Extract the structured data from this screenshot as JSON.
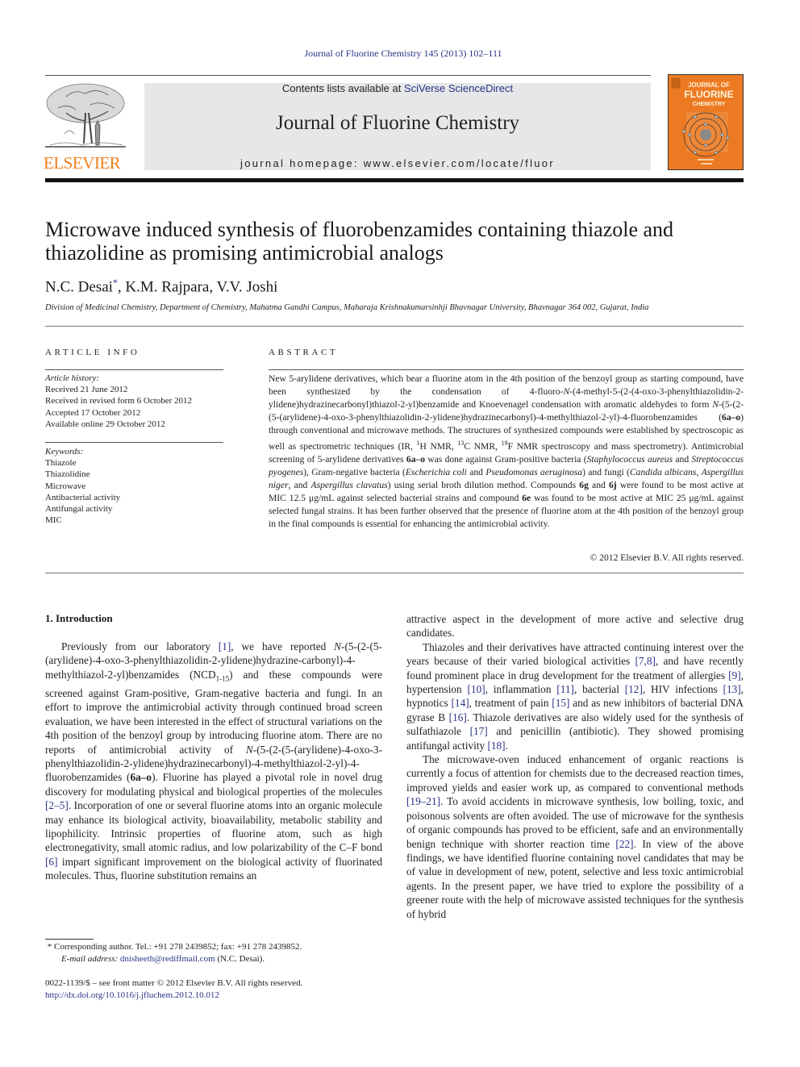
{
  "header": {
    "citation": "Journal of Fluorine Chemistry 145 (2013) 102–111",
    "contents_prefix": "Contents lists available at ",
    "contents_link": "SciVerse ScienceDirect",
    "journal_name": "Journal of Fluorine Chemistry",
    "homepage": "journal homepage: www.elsevier.com/locate/fluor",
    "publisher_wordmark": "ELSEVIER",
    "cover": {
      "line1": "JOURNAL OF",
      "line2": "FLUORINE",
      "line3": "CHEMISTRY"
    },
    "colors": {
      "link": "#2a3388",
      "elsevier_orange": "#f07f1b",
      "cover_orange": "#ec7a22",
      "header_gray": "#e6e7e8"
    }
  },
  "article": {
    "title": "Microwave induced synthesis of fluorobenzamides containing thiazole and thiazolidine as promising antimicrobial analogs",
    "authors": [
      {
        "name": "N.C. Desai",
        "mark": "*"
      },
      {
        "name": "K.M. Rajpara",
        "mark": ""
      },
      {
        "name": "V.V. Joshi",
        "mark": ""
      }
    ],
    "affiliation": "Division of Medicinal Chemistry, Department of Chemistry, Mahatma Gandhi Campus, Maharaja Krishnakumarsinhji Bhavnagar University, Bhavnagar 364 002, Gujarat, India"
  },
  "article_info": {
    "label": "ARTICLE INFO",
    "history_heading": "Article history:",
    "history": [
      "Received 21 June 2012",
      "Received in revised form 6 October 2012",
      "Accepted 17 October 2012",
      "Available online 29 October 2012"
    ],
    "keywords_heading": "Keywords:",
    "keywords": [
      "Thiazole",
      "Thiazolidine",
      "Microwave",
      "Antibacterial activity",
      "Antifungal activity",
      "MIC"
    ]
  },
  "abstract": {
    "label": "ABSTRACT",
    "segments": [
      {
        "t": "New 5-arylidene derivatives, which bear a fluorine atom in the 4th position of the benzoyl group as starting compound, have been synthesized by the condensation of 4-fluoro-"
      },
      {
        "t": "N",
        "s": "i"
      },
      {
        "t": "-(4-methyl-5-(2-(4-oxo-3-phenylthiazolidin-2-ylidene)hydrazinecarbonyl)thiazol-2-yl)benzamide and Knoevenagel condensation with aromatic aldehydes to form "
      },
      {
        "t": "N",
        "s": "i"
      },
      {
        "t": "-(5-(2-(5-(arylidene)-4-oxo-3-phenylthiazolidin-2-ylidene)hydrazinecarbonyl)-4-methylthiazol-2-yl)-4-fluorobenzamides ("
      },
      {
        "t": "6a–o",
        "s": "b"
      },
      {
        "t": ") through conventional and microwave methods. The structures of synthesized compounds were established by spectroscopic as well as spectrometric techniques (IR, "
      },
      {
        "t": "1",
        "s": "sup"
      },
      {
        "t": "H NMR, "
      },
      {
        "t": "13",
        "s": "sup"
      },
      {
        "t": "C NMR, "
      },
      {
        "t": "19",
        "s": "sup"
      },
      {
        "t": "F NMR spectroscopy and mass spectrometry). Antimicrobial screening of 5-arylidene derivatives "
      },
      {
        "t": "6a–o",
        "s": "b"
      },
      {
        "t": " was done against Gram-positive bacteria ("
      },
      {
        "t": "Staphylococcus aureus",
        "s": "i"
      },
      {
        "t": " and "
      },
      {
        "t": "Streptococcus pyogenes",
        "s": "i"
      },
      {
        "t": "), Gram-negative bacteria ("
      },
      {
        "t": "Escherichia coli",
        "s": "i"
      },
      {
        "t": " and "
      },
      {
        "t": "Pseudomonas aeruginosa",
        "s": "i"
      },
      {
        "t": ") and fungi ("
      },
      {
        "t": "Candida albicans",
        "s": "i"
      },
      {
        "t": ", "
      },
      {
        "t": "Aspergillus niger",
        "s": "i"
      },
      {
        "t": ", and "
      },
      {
        "t": "Aspergillus clavatus",
        "s": "i"
      },
      {
        "t": ") using serial broth dilution method. Compounds "
      },
      {
        "t": "6g",
        "s": "b"
      },
      {
        "t": " and "
      },
      {
        "t": "6j",
        "s": "b"
      },
      {
        "t": " were found to be most active at MIC 12.5 μg/mL against selected bacterial strains and compound "
      },
      {
        "t": "6e",
        "s": "b"
      },
      {
        "t": " was found to be most active at MIC 25 μg/mL against selected fungal strains. It has been further observed that the presence of fluorine atom at the 4th position of the benzoyl group in the final compounds is essential for enhancing the antimicrobial activity."
      }
    ],
    "copyright": "© 2012 Elsevier B.V. All rights reserved."
  },
  "introduction": {
    "heading": "1.  Introduction",
    "left_paragraphs": [
      [
        {
          "t": "Previously from our laboratory "
        },
        {
          "t": "[1]",
          "s": "ref"
        },
        {
          "t": ", we have reported "
        },
        {
          "t": "N",
          "s": "i"
        },
        {
          "t": "-(5-(2-(5-(arylidene)-4-oxo-3-phenylthiazolidin-2-ylidene)hydrazine-carbonyl)-4-methylthiazol-2-yl)benzamides (NCD"
        },
        {
          "t": "1-15",
          "s": "sub"
        },
        {
          "t": ") and these compounds were screened against Gram-positive, Gram-negative bacteria and fungi. In an effort to improve the antimicrobial activity through continued broad screen evaluation, we have been interested in the effect of structural variations on the 4th position of the benzoyl group by introducing fluorine atom. There are no reports of antimicrobial activity of "
        },
        {
          "t": "N",
          "s": "i"
        },
        {
          "t": "-(5-(2-(5-(arylidene)-4-oxo-3-phenylthiazolidin-2-ylidene)hydrazinecarbonyl)-4-methylthiazol-2-yl)-4-fluorobenzamides ("
        },
        {
          "t": "6a–o",
          "s": "b"
        },
        {
          "t": "). Fluorine has played a pivotal role in novel drug discovery for modulating physical and biological properties of the molecules "
        },
        {
          "t": "[2–5]",
          "s": "ref"
        },
        {
          "t": ". Incorporation of one or several fluorine atoms into an organic molecule may enhance its biological activity, bioavailability, metabolic stability and lipophilicity. Intrinsic properties of fluorine atom, such as high electronegativity, small atomic radius, and low polarizability of the C–F bond "
        },
        {
          "t": "[6]",
          "s": "ref"
        },
        {
          "t": " impart significant improvement on the biological activity of fluorinated molecules. Thus, fluorine substitution remains an"
        }
      ]
    ],
    "right_paragraphs": [
      [
        {
          "t": "attractive aspect in the development of more active and selective drug candidates."
        }
      ],
      [
        {
          "t": "Thiazoles and their derivatives have attracted continuing interest over the years because of their varied biological activities "
        },
        {
          "t": "[7,8]",
          "s": "ref"
        },
        {
          "t": ", and have recently found prominent place in drug development for the treatment of allergies "
        },
        {
          "t": "[9]",
          "s": "ref"
        },
        {
          "t": ", hypertension "
        },
        {
          "t": "[10]",
          "s": "ref"
        },
        {
          "t": ", inflammation "
        },
        {
          "t": "[11]",
          "s": "ref"
        },
        {
          "t": ", bacterial "
        },
        {
          "t": "[12]",
          "s": "ref"
        },
        {
          "t": ", HIV infections "
        },
        {
          "t": "[13]",
          "s": "ref"
        },
        {
          "t": ", hypnotics "
        },
        {
          "t": "[14]",
          "s": "ref"
        },
        {
          "t": ", treatment of pain "
        },
        {
          "t": "[15]",
          "s": "ref"
        },
        {
          "t": " and as new inhibitors of bacterial DNA gyrase B "
        },
        {
          "t": "[16]",
          "s": "ref"
        },
        {
          "t": ". Thiazole derivatives are also widely used for the synthesis of sulfathiazole "
        },
        {
          "t": "[17]",
          "s": "ref"
        },
        {
          "t": " and penicillin (antibiotic). They showed promising antifungal activity "
        },
        {
          "t": "[18]",
          "s": "ref"
        },
        {
          "t": "."
        }
      ],
      [
        {
          "t": "The microwave-oven induced enhancement of organic reactions is currently a focus of attention for chemists due to the decreased reaction times, improved yields and easier work up, as compared to conventional methods "
        },
        {
          "t": "[19–21]",
          "s": "ref"
        },
        {
          "t": ". To avoid accidents in microwave synthesis, low boiling, toxic, and poisonous solvents are often avoided. The use of microwave for the synthesis of organic compounds has proved to be efficient, safe and an environmentally benign technique with shorter reaction time "
        },
        {
          "t": "[22]",
          "s": "ref"
        },
        {
          "t": ". In view of the above findings, we have identified fluorine containing novel candidates that may be of value in development of new, potent, selective and less toxic antimicrobial agents. In the present paper, we have tried to explore the possibility of a greener route with the help of microwave assisted techniques for the synthesis of hybrid"
        }
      ]
    ]
  },
  "footnote": {
    "mark": "*",
    "corresponding": "Corresponding author. Tel.: +91 278 2439852; fax: +91 278 2439852.",
    "email_label": "E-mail address:",
    "email": "dnisheeth@rediffmail.com",
    "email_suffix": " (N.C. Desai).",
    "front_matter": "0022-1139/$ – see front matter © 2012 Elsevier B.V. All rights reserved.",
    "doi": "http://dx.doi.org/10.1016/j.jfluchem.2012.10.012"
  }
}
